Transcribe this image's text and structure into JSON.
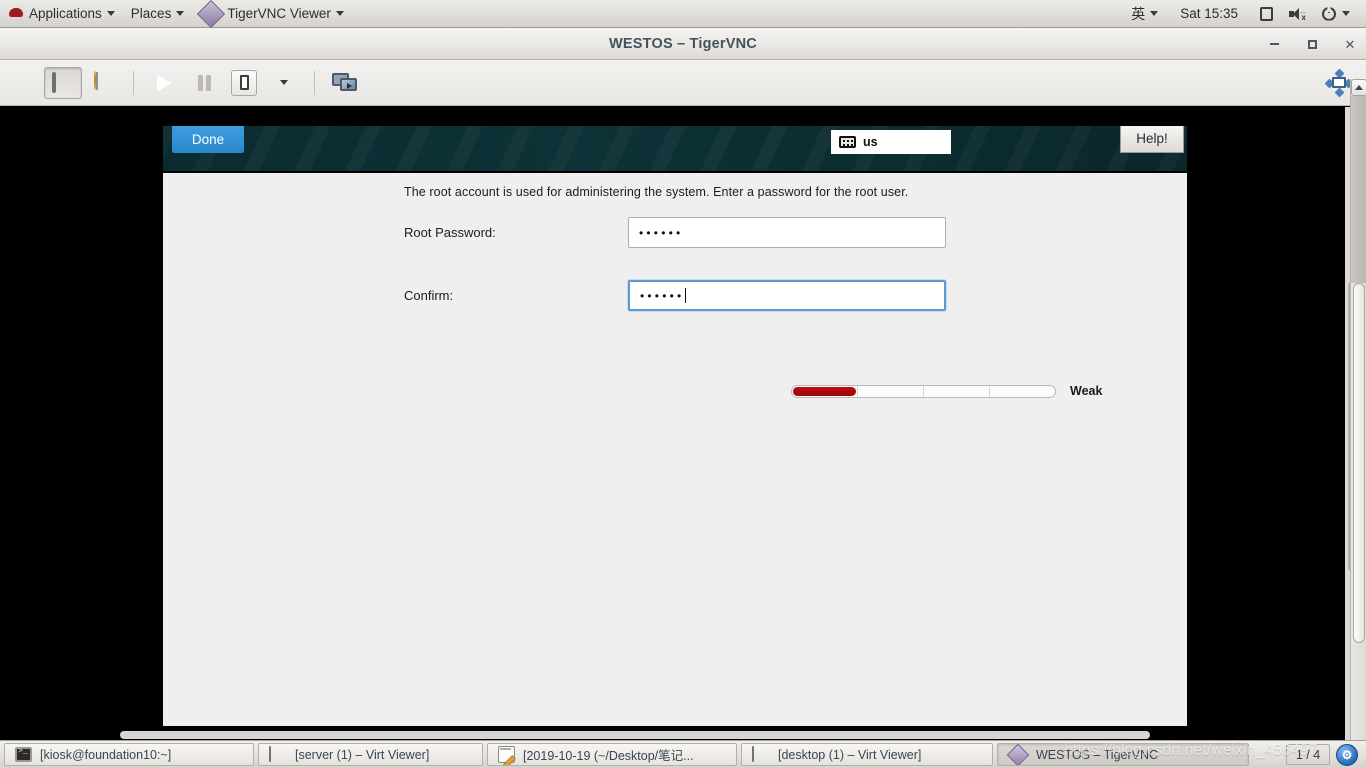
{
  "top_panel": {
    "applications_label": "Applications",
    "places_label": "Places",
    "active_app_label": "TigerVNC Viewer",
    "input_method": "英",
    "clock": "Sat 15:35",
    "icons": {
      "redhat": "redhat-logo-icon",
      "display": "display-icon",
      "volume_muted": "volume-muted-icon",
      "power": "power-icon"
    }
  },
  "vnc_window": {
    "title": "WESTOS – TigerVNC",
    "window_buttons": {
      "minimize": "–",
      "maximize": "❐",
      "close": "✕"
    },
    "toolbar": {
      "items": [
        {
          "name": "fullscreen-toggle",
          "icon": "monitor-icon",
          "pressed": true
        },
        {
          "name": "hint-toggle",
          "icon": "lightbulb-icon",
          "pressed": false
        },
        {
          "name": "play-button",
          "icon": "play-icon",
          "pressed": false
        },
        {
          "name": "pause-button",
          "icon": "pause-icon",
          "pressed": false
        },
        {
          "name": "snapshot-button",
          "icon": "snapshot-icon",
          "pressed": false
        },
        {
          "name": "toolbar-menu",
          "icon": "chevron-down-icon",
          "pressed": false
        },
        {
          "name": "screens-button",
          "icon": "multi-monitor-icon",
          "pressed": false
        }
      ],
      "fit_window": "fit-window-icon"
    }
  },
  "installer": {
    "done_label": "Done",
    "help_label": "Help!",
    "keyboard_layout": "us",
    "keyboard_icon": "keyboard-icon",
    "description": "The root account is used for administering the system.  Enter a password for the root user.",
    "fields": [
      {
        "label": "Root Password:",
        "value": "••••••",
        "focused": false
      },
      {
        "label": "Confirm:",
        "value": "••••••",
        "focused": true
      }
    ],
    "password_strength": {
      "label": "Weak",
      "percent": 24,
      "color": "#bb0d0d"
    }
  },
  "taskbar": {
    "buttons": [
      {
        "label": "[kiosk@foundation10:~]",
        "icon": "terminal-icon",
        "active": false
      },
      {
        "label": "[server (1) – Virt Viewer]",
        "icon": "monitor-icon",
        "active": false
      },
      {
        "label": "[2019-10-19 (~/Desktop/笔记...",
        "icon": "notepad-icon",
        "active": false
      },
      {
        "label": "[desktop (1) – Virt Viewer]",
        "icon": "monitor-icon",
        "active": false
      },
      {
        "label": "WESTOS – TigerVNC",
        "icon": "tigervnc-icon",
        "active": true
      }
    ],
    "workspace_indicator": "1 / 4",
    "tray_icon": "network-icon"
  },
  "watermark": "https://blog.csdn.net/weixin_456497"
}
